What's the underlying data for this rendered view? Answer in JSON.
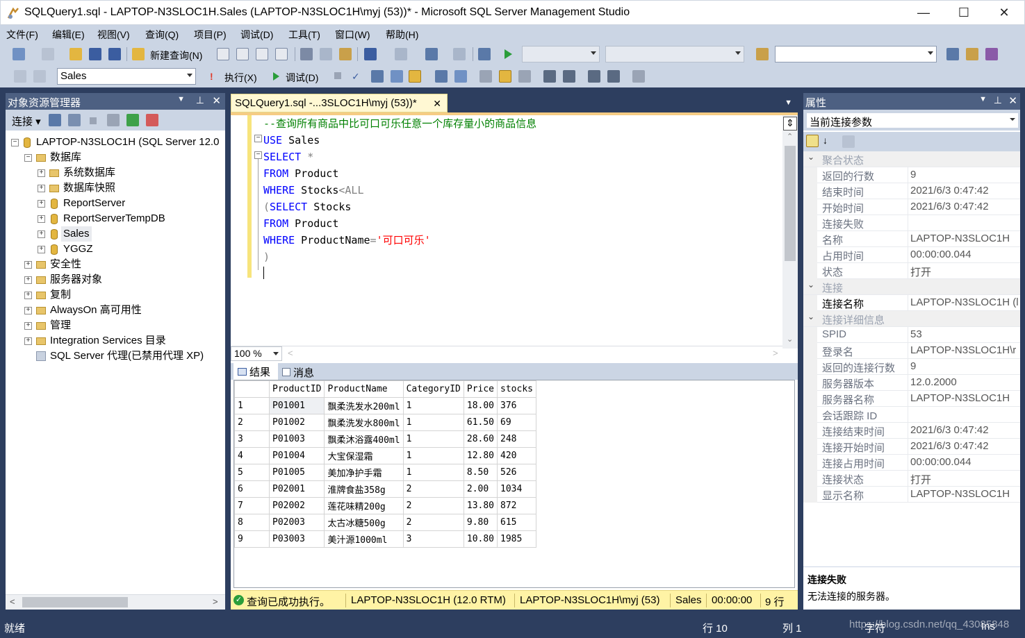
{
  "window": {
    "title": "SQLQuery1.sql - LAPTOP-N3SLOC1H.Sales (LAPTOP-N3SLOC1H\\myj (53))* - Microsoft SQL Server Management Studio",
    "minimize": "—",
    "maximize": "☐",
    "close": "✕"
  },
  "menu": [
    "文件(F)",
    "编辑(E)",
    "视图(V)",
    "查询(Q)",
    "项目(P)",
    "调试(D)",
    "工具(T)",
    "窗口(W)",
    "帮助(H)"
  ],
  "toolbar": {
    "new_query": "新建查询(N)",
    "database": "Sales",
    "execute": "执行(X)",
    "debug": "调试(D)"
  },
  "object_explorer": {
    "title": "对象资源管理器",
    "connect": "连接",
    "server": "LAPTOP-N3SLOC1H (SQL Server 12.0",
    "databases": "数据库",
    "system_db": "系统数据库",
    "db_snapshot": "数据库快照",
    "dbs": [
      "ReportServer",
      "ReportServerTempDB",
      "Sales",
      "YGGZ"
    ],
    "security": "安全性",
    "server_objects": "服务器对象",
    "replication": "复制",
    "alwayson": "AlwaysOn 高可用性",
    "management": "管理",
    "integration": "Integration Services 目录",
    "agent": "SQL Server 代理(已禁用代理 XP)"
  },
  "editor": {
    "tab_title": "SQLQuery1.sql -...3SLOC1H\\myj (53))*",
    "tab_close": "✕",
    "code": {
      "l1": "--查询所有商品中比可口可乐任意一个库存量小的商品信息",
      "l2_kw": "USE",
      "l2_rest": " Sales",
      "l3_kw": "SELECT",
      "l3_rest": " *",
      "l4_kw": "FROM",
      "l4_rest": " Product",
      "l5_kw": "WHERE",
      "l5_rest": " Stocks",
      "l5_op": "<ALL",
      "l6_open": "(",
      "l6_kw": "SELECT",
      "l6_rest": " Stocks",
      "l7_kw": "FROM",
      "l7_rest": " Product",
      "l8_kw": "WHERE",
      "l8_rest": " ProductName",
      "l8_eq": "=",
      "l8_str": "'可口可乐'",
      "l9": ")"
    },
    "zoom": "100 %",
    "tab_results": "结果",
    "tab_messages": "消息"
  },
  "results": {
    "columns": [
      "ProductID",
      "ProductName",
      "CategoryID",
      "Price",
      "stocks"
    ],
    "rows": [
      [
        "1",
        "P01001",
        "飘柔洗发水200ml",
        "1",
        "18.00",
        "376"
      ],
      [
        "2",
        "P01002",
        "飘柔洗发水800ml",
        "1",
        "61.50",
        "69"
      ],
      [
        "3",
        "P01003",
        "飘柔沐浴露400ml",
        "1",
        "28.60",
        "248"
      ],
      [
        "4",
        "P01004",
        "大宝保湿霜",
        "1",
        "12.80",
        "420"
      ],
      [
        "5",
        "P01005",
        "美加净护手霜",
        "1",
        "8.50",
        "526"
      ],
      [
        "6",
        "P02001",
        "淮牌食盐358g",
        "2",
        "2.00",
        "1034"
      ],
      [
        "7",
        "P02002",
        "莲花味精200g",
        "2",
        "13.80",
        "872"
      ],
      [
        "8",
        "P02003",
        "太古冰糖500g",
        "2",
        "9.80",
        "615"
      ],
      [
        "9",
        "P03003",
        "美汁源1000ml",
        "3",
        "10.80",
        "1985"
      ]
    ]
  },
  "query_status": {
    "message": "查询已成功执行。",
    "server": "LAPTOP-N3SLOC1H (12.0 RTM)",
    "user": "LAPTOP-N3SLOC1H\\myj (53)",
    "db": "Sales",
    "time": "00:00:00",
    "rows": "9 行"
  },
  "properties": {
    "title": "属性",
    "selector": "当前连接参数",
    "cat1": "聚合状态",
    "cat2": "连接",
    "cat3": "连接详细信息",
    "agg": [
      [
        "返回的行数",
        "9"
      ],
      [
        "结束时间",
        "2021/6/3 0:47:42"
      ],
      [
        "开始时间",
        "2021/6/3 0:47:42"
      ],
      [
        "连接失败",
        ""
      ],
      [
        "名称",
        "LAPTOP-N3SLOC1H"
      ],
      [
        "占用时间",
        "00:00:00.044"
      ],
      [
        "状态",
        "打开"
      ]
    ],
    "conn": [
      [
        "连接名称",
        "LAPTOP-N3SLOC1H (l"
      ]
    ],
    "detail": [
      [
        "SPID",
        "53"
      ],
      [
        "登录名",
        "LAPTOP-N3SLOC1H\\r"
      ],
      [
        "返回的连接行数",
        "9"
      ],
      [
        "服务器版本",
        "12.0.2000"
      ],
      [
        "服务器名称",
        "LAPTOP-N3SLOC1H"
      ],
      [
        "会话跟踪 ID",
        ""
      ],
      [
        "连接结束时间",
        "2021/6/3 0:47:42"
      ],
      [
        "连接开始时间",
        "2021/6/3 0:47:42"
      ],
      [
        "连接占用时间",
        "00:00:00.044"
      ],
      [
        "连接状态",
        "打开"
      ],
      [
        "显示名称",
        "LAPTOP-N3SLOC1H"
      ]
    ],
    "desc_title": "连接失败",
    "desc_text": "无法连接的服务器。"
  },
  "statusbar": {
    "ready": "就绪",
    "row": "行 10",
    "col": "列 1",
    "ch": "字符",
    "ins": "Ins",
    "watermark": "https://blog.csdn.net/qq_43085848"
  }
}
